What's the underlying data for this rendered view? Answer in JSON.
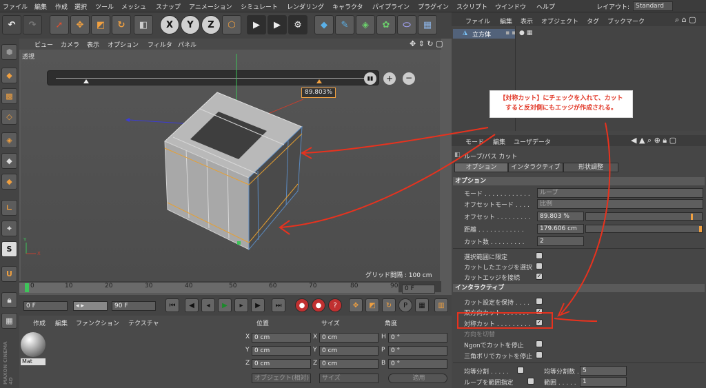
{
  "menubar": {
    "items": [
      "ファイル",
      "編集",
      "作成",
      "選択",
      "ツール",
      "メッシュ",
      "スナップ",
      "アニメーション",
      "シミュレート",
      "レンダリング",
      "キャラクタ",
      "パイプライン",
      "プラグイン",
      "スクリプト",
      "ウインドウ",
      "ヘルプ"
    ],
    "layout_label": "レイアウト:",
    "layout_value": "Standard"
  },
  "toolbar": {
    "x_label": "X",
    "y_label": "Y",
    "z_label": "Z"
  },
  "viewport": {
    "menu": [
      "ビュー",
      "カメラ",
      "表示",
      "オプション",
      "フィルタ",
      "パネル"
    ],
    "name": "透視",
    "offset_readout": "89.803%",
    "grid_text": "グリッド間隔 : 100 cm"
  },
  "timeline": {
    "ticks": [
      "0",
      "10",
      "20",
      "30",
      "40",
      "50",
      "60",
      "70",
      "80",
      "90"
    ],
    "frame": "0 F",
    "start": "0 F",
    "end": "90 F"
  },
  "material_panel": {
    "menu": [
      "作成",
      "編集",
      "ファンクション",
      "テクスチャ"
    ],
    "material_name": "Mat"
  },
  "coord_panel": {
    "headers": [
      "位置",
      "サイズ",
      "角度"
    ],
    "rows": [
      {
        "a": "X",
        "av": "0 cm",
        "b": "X",
        "bv": "0 cm",
        "c": "H",
        "cv": "0 °"
      },
      {
        "a": "Y",
        "av": "0 cm",
        "b": "Y",
        "bv": "0 cm",
        "c": "P",
        "cv": "0 °"
      },
      {
        "a": "Z",
        "av": "0 cm",
        "b": "Z",
        "bv": "0 cm",
        "c": "B",
        "cv": "0 °"
      }
    ],
    "mode": "オブジェクト(相対)",
    "size_mode": "サイズ",
    "apply": "適用"
  },
  "object_manager": {
    "menu": [
      "ファイル",
      "編集",
      "表示",
      "オブジェクト",
      "タグ",
      "ブックマーク"
    ],
    "object_name": "立方体"
  },
  "attributes": {
    "menu": [
      "モード",
      "編集",
      "ユーザデータ"
    ],
    "tool_name": "ループ/パス カット",
    "tabs": [
      "オプション",
      "インタラクティブ",
      "形状調整"
    ],
    "section_options": "オプション",
    "mode_label": "モード",
    "mode_value": "ループ",
    "offset_mode_label": "オフセットモード",
    "offset_mode_value": "比例",
    "offset_label": "オフセット",
    "offset_value": "89.803 %",
    "distance_label": "距離",
    "distance_value": "179.606 cm",
    "cut_count_label": "カット数",
    "cut_count_value": "2",
    "limit_selection": "選択範囲に限定",
    "select_cut_edges": "カットしたエッジを選択",
    "connect_cut_edges": "カットエッジを接続",
    "section_interactive": "インタラクティブ",
    "keep_cut_settings": "カット設定を保持",
    "bidirectional": "双方向カット",
    "symmetric_cut": "対称カット",
    "flip_direction": "方向を切替",
    "stop_ngon": "Ngonでカットを停止",
    "stop_triangle": "三角ポリでカットを停止",
    "even_split": "均等分割",
    "even_split_count_label": "均等分割数",
    "even_split_count_value": "5",
    "loop_range": "ループを範囲指定",
    "range_label": "範囲",
    "range_value": "1"
  },
  "annotation": {
    "callout_line1": "【対称カット】にチェックを入れて、カット",
    "callout_line2": "すると反対側にもエッジが作成される。"
  },
  "colors": {
    "accent": "#f0a040",
    "annotation_red": "#e8321e"
  }
}
